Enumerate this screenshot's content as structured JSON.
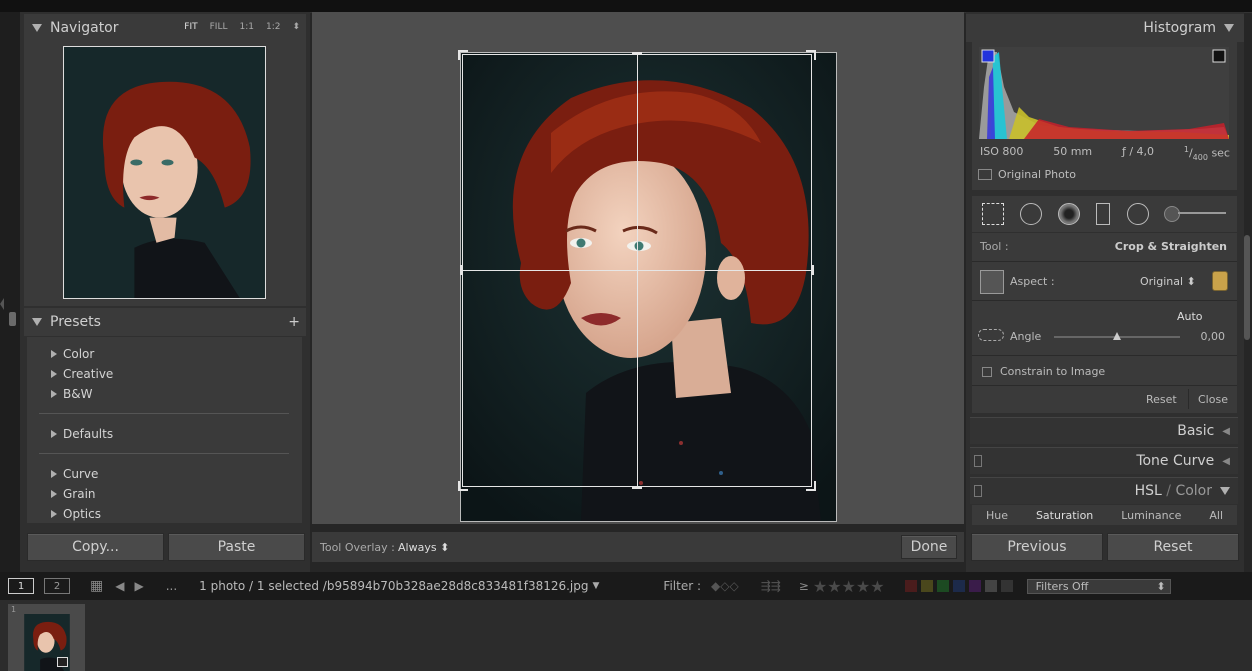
{
  "navigator": {
    "title": "Navigator",
    "zoom": [
      "FIT",
      "FILL",
      "1:1",
      "1:2"
    ]
  },
  "presets": {
    "title": "Presets",
    "groups": [
      "Color",
      "Creative",
      "B&W",
      "Defaults",
      "Curve",
      "Grain",
      "Optics"
    ]
  },
  "left_buttons": {
    "copy": "Copy...",
    "paste": "Paste"
  },
  "toolbar": {
    "overlay_label": "Tool Overlay :",
    "overlay_value": "Always",
    "done": "Done"
  },
  "histogram": {
    "title": "Histogram",
    "iso": "ISO 800",
    "focal": "50 mm",
    "aperture": "ƒ / 4,0",
    "shutter_num": "1",
    "shutter_den": "400",
    "shutter_unit": "sec",
    "original_photo": "Original Photo"
  },
  "crop": {
    "tool_label": "Tool :",
    "tool_value": "Crop & Straighten",
    "aspect_label": "Aspect :",
    "aspect_value": "Original",
    "auto": "Auto",
    "angle_label": "Angle",
    "angle_value": "0,00",
    "constrain": "Constrain to Image",
    "reset": "Reset",
    "close": "Close"
  },
  "sections": {
    "basic": "Basic",
    "tone_curve": "Tone Curve",
    "hsl": "HSL",
    "color": "Color"
  },
  "hsl_tabs": [
    "Hue",
    "Saturation",
    "Luminance",
    "All"
  ],
  "right_buttons": {
    "previous": "Previous",
    "reset": "Reset"
  },
  "filmbar": {
    "page1": "1",
    "page2": "2",
    "ellipsis": "...",
    "status": "1 photo / 1 selected /b95894b70b328ae28d8c833481f38126.jpg",
    "filter_label": "Filter :",
    "filters_off": "Filters Off",
    "rating_op": "≥"
  },
  "filmstrip": {
    "index": "1"
  },
  "colors": {
    "panel": "#3a3a3a",
    "dark": "#262626",
    "hair": "#7a1e10",
    "sweater": "#111418"
  }
}
